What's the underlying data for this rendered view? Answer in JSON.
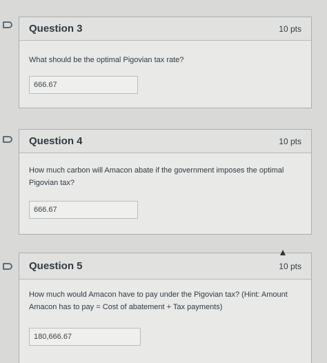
{
  "questions": [
    {
      "title": "Question 3",
      "points": "10 pts",
      "text": "What should be the optimal Pigovian tax rate?",
      "answer": "666.67"
    },
    {
      "title": "Question 4",
      "points": "10 pts",
      "text": "How much carbon will Amacon abate if the government imposes the optimal Pigovian tax?",
      "answer": "666.67"
    },
    {
      "title": "Question 5",
      "points": "10 pts",
      "text": "How much would Amacon have to pay under the Pigovian tax? (Hint: Amount Amacon has to pay = Cost of abatement + Tax payments)",
      "answer": "180,666.67"
    }
  ]
}
